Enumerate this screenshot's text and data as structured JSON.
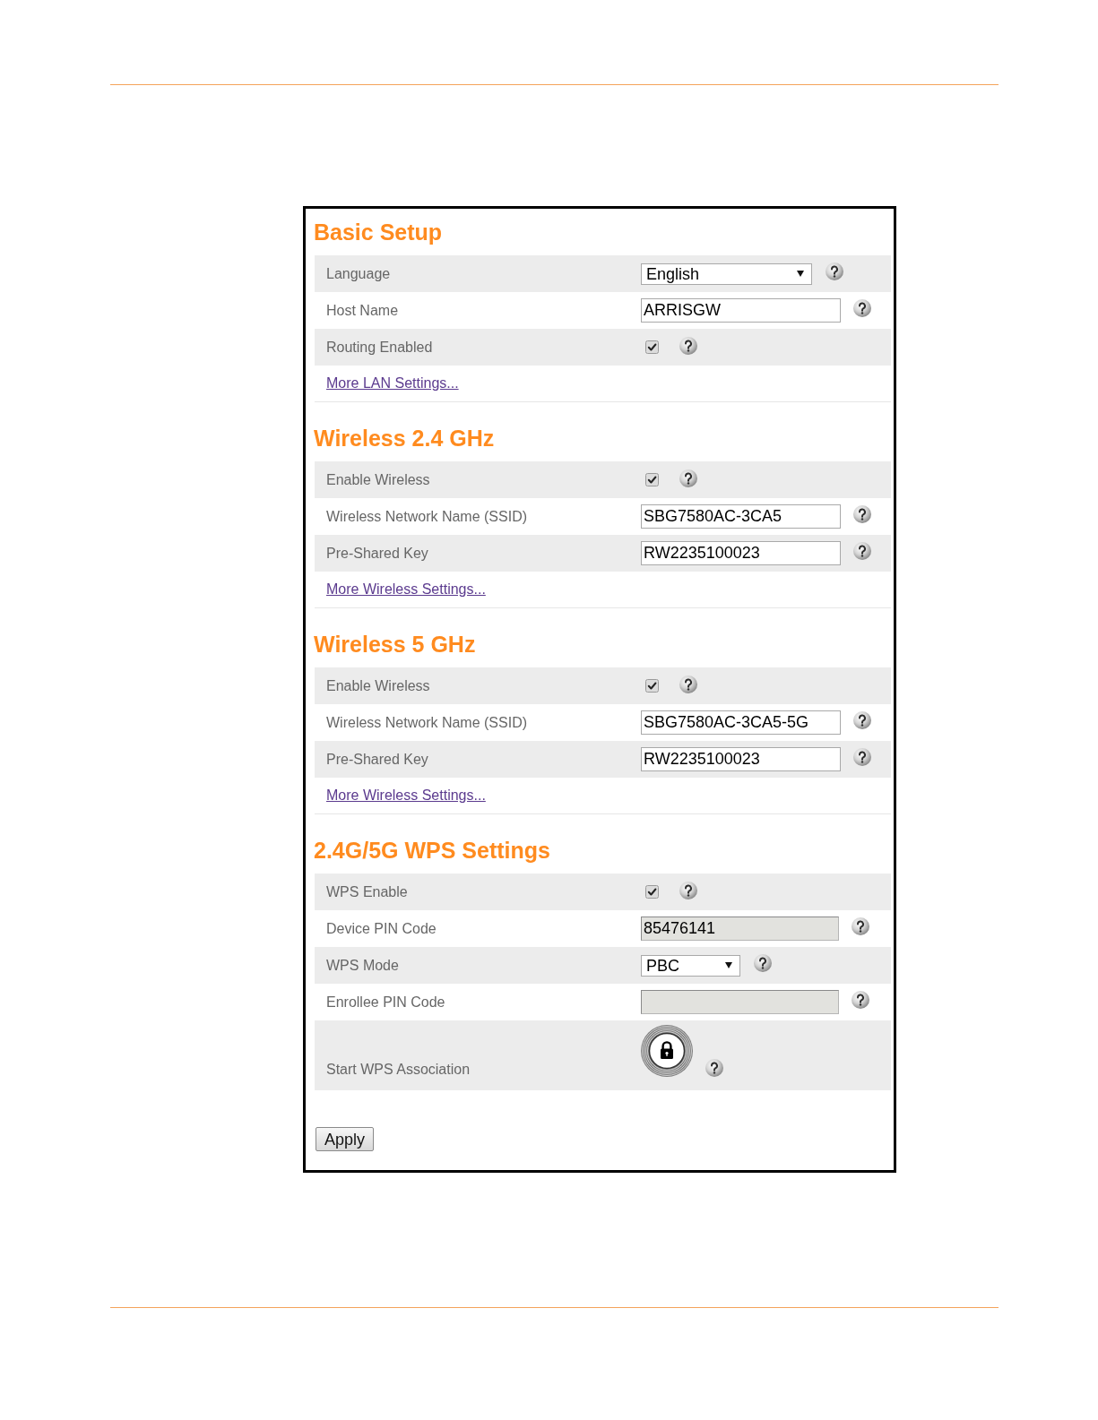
{
  "sections": [
    {
      "title": "Basic Setup",
      "rows": [
        {
          "kind": "select",
          "label": "Language",
          "value": "English",
          "disabled": false
        },
        {
          "kind": "text",
          "label": "Host Name",
          "value": "ARRISGW",
          "disabled": false
        },
        {
          "kind": "checkbox",
          "label": "Routing Enabled",
          "checked": true,
          "disabled": false
        }
      ],
      "link": "More LAN Settings..."
    },
    {
      "title": "Wireless 2.4 GHz",
      "rows": [
        {
          "kind": "checkbox",
          "label": "Enable Wireless",
          "checked": true,
          "disabled": false
        },
        {
          "kind": "text",
          "label": "Wireless Network Name (SSID)",
          "value": "SBG7580AC-3CA5",
          "disabled": false
        },
        {
          "kind": "text",
          "label": "Pre-Shared Key",
          "value": "RW2235100023",
          "disabled": false
        }
      ],
      "link": "More Wireless Settings..."
    },
    {
      "title": "Wireless 5 GHz",
      "rows": [
        {
          "kind": "checkbox",
          "label": "Enable Wireless",
          "checked": true,
          "disabled": false
        },
        {
          "kind": "text",
          "label": "Wireless Network Name (SSID)",
          "value": "SBG7580AC-3CA5-5G",
          "disabled": false
        },
        {
          "kind": "text",
          "label": "Pre-Shared Key",
          "value": "RW2235100023",
          "disabled": false
        }
      ],
      "link": "More Wireless Settings..."
    },
    {
      "title": "2.4G/5G WPS Settings",
      "rows": [
        {
          "kind": "checkbox",
          "label": "WPS Enable",
          "checked": true,
          "disabled": false
        },
        {
          "kind": "text",
          "label": "Device PIN Code",
          "value": "85476141",
          "disabled": true
        },
        {
          "kind": "select",
          "label": "WPS Mode",
          "value": "PBC",
          "disabled": false
        },
        {
          "kind": "text",
          "label": "Enrollee PIN Code",
          "disabled": true
        },
        {
          "kind": "push_button",
          "label": "Start WPS Association",
          "disabled": false
        }
      ]
    }
  ],
  "apply_button": "Apply"
}
